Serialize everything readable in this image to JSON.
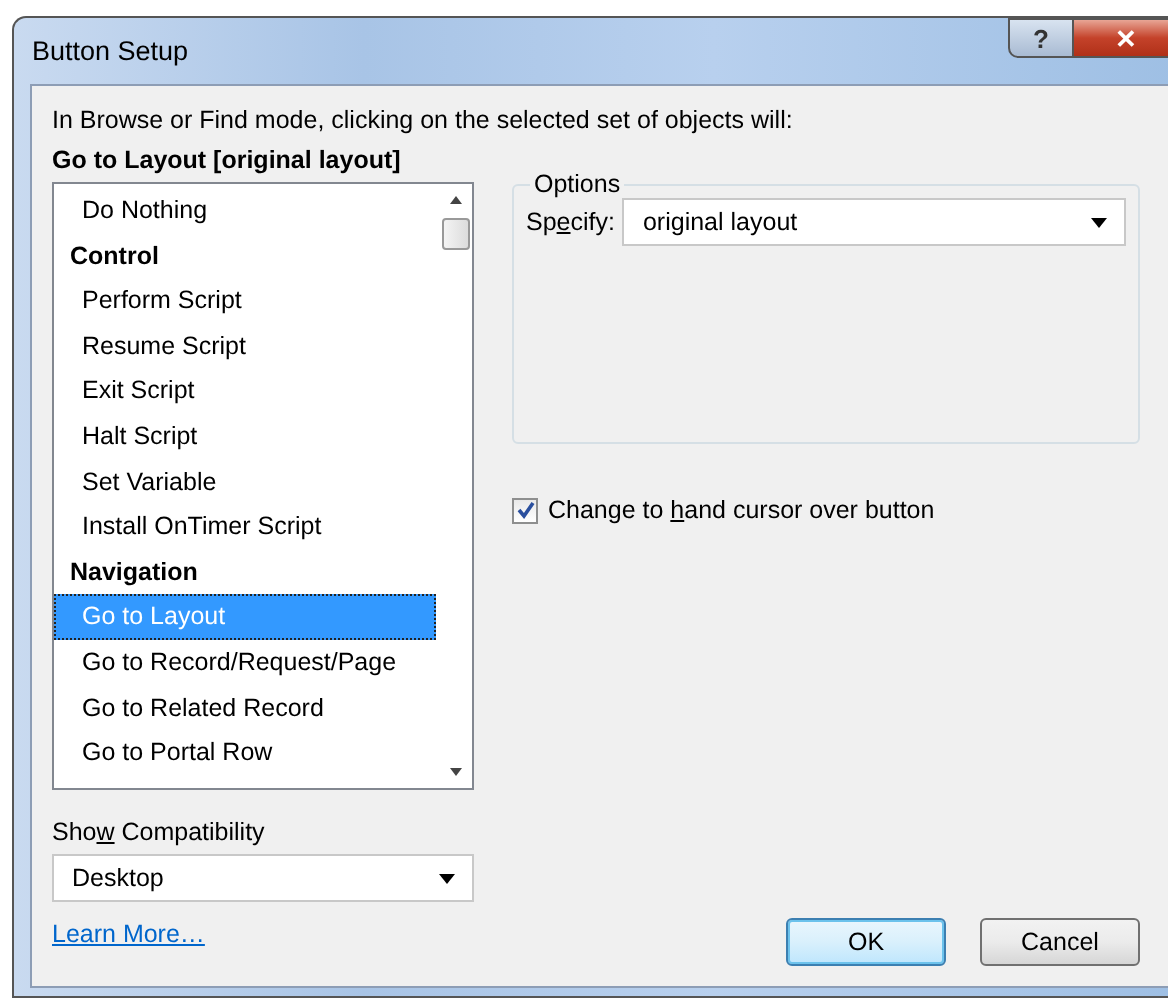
{
  "window": {
    "title": "Button Setup",
    "buttons": [
      "?",
      "✕"
    ]
  },
  "instruction": "In Browse or Find mode, clicking on the selected set of objects will:",
  "current_action": "Go to Layout [original layout]",
  "action_list": {
    "items": [
      {
        "label": "Do Nothing",
        "kind": "item",
        "selected": false
      },
      {
        "label": "Control",
        "kind": "header",
        "selected": false
      },
      {
        "label": "Perform Script",
        "kind": "item",
        "selected": false
      },
      {
        "label": "Resume Script",
        "kind": "item",
        "selected": false
      },
      {
        "label": "Exit Script",
        "kind": "item",
        "selected": false
      },
      {
        "label": "Halt Script",
        "kind": "item",
        "selected": false
      },
      {
        "label": "Set Variable",
        "kind": "item",
        "selected": false
      },
      {
        "label": "Install OnTimer Script",
        "kind": "item",
        "selected": false
      },
      {
        "label": "Navigation",
        "kind": "header",
        "selected": false
      },
      {
        "label": "Go to Layout",
        "kind": "item",
        "selected": true
      },
      {
        "label": "Go to Record/Request/Page",
        "kind": "item",
        "selected": false
      },
      {
        "label": "Go to Related Record",
        "kind": "item",
        "selected": false
      },
      {
        "label": "Go to Portal Row",
        "kind": "item",
        "selected": false
      }
    ]
  },
  "options": {
    "title": "Options",
    "specify": {
      "label": {
        "before": "Sp",
        "key": "e",
        "after": "cify:"
      },
      "value": "original layout"
    }
  },
  "hand_cursor": {
    "label": {
      "before": "Change to ",
      "key": "h",
      "after": "and cursor over button"
    },
    "checked": true
  },
  "compatibility": {
    "label": {
      "before": "Sho",
      "key": "w",
      "after": " Compatibility"
    },
    "value": "Desktop"
  },
  "learn_more": "Learn More…",
  "buttons": [
    {
      "label": "OK",
      "kind": "default"
    },
    {
      "label": "Cancel",
      "kind": "normal"
    }
  ]
}
